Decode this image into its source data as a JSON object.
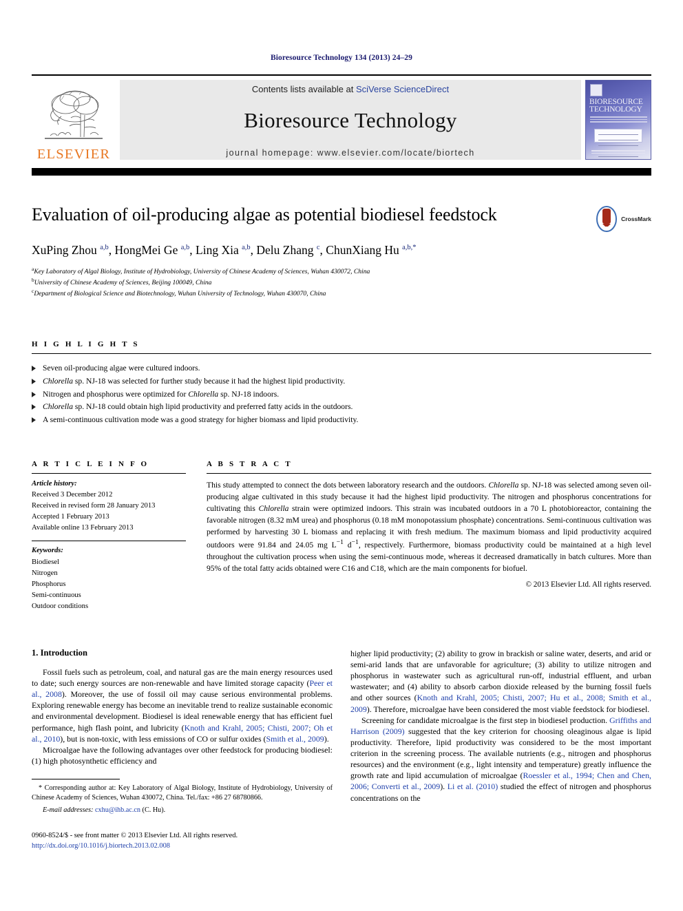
{
  "running_head": "Bioresource Technology 134 (2013) 24–29",
  "masthead": {
    "publisher_name": "ELSEVIER",
    "contents_prefix": "Contents lists available at ",
    "contents_link": "SciVerse ScienceDirect",
    "journal_name": "Bioresource Technology",
    "homepage": "journal homepage: www.elsevier.com/locate/biortech",
    "cover_title_line1": "BIORESOURCE",
    "cover_title_line2": "TECHNOLOGY"
  },
  "article": {
    "title": "Evaluation of oil-producing algae as potential biodiesel feedstock",
    "crossmark_label": "CrossMark",
    "authors_html": "XuPing Zhou <sup>a,b</sup>, HongMei Ge <sup>a,b</sup>, Ling Xia <sup>a,b</sup>, Delu Zhang <sup>c</sup>, ChunXiang Hu <sup>a,b,</sup><sup>*</sup>",
    "affiliations": [
      "Key Laboratory of Algal Biology, Institute of Hydrobiology, University of Chinese Academy of Sciences, Wuhan 430072, China",
      "University of Chinese Academy of Sciences, Beijing 100049, China",
      "Department of Biological Science and Biotechnology, Wuhan University of Technology, Wuhan 430070, China"
    ],
    "affiliation_marks": [
      "a",
      "b",
      "c"
    ]
  },
  "highlights": {
    "heading": "H I G H L I G H T S",
    "items_html": [
      "Seven oil-producing algae were cultured indoors.",
      "<i>Chlorella</i> sp. NJ-18 was selected for further study because it had the highest lipid productivity.",
      "Nitrogen and phosphorus were optimized for <i>Chlorella</i> sp. NJ-18 indoors.",
      "<i>Chlorella</i> sp. NJ-18 could obtain high lipid productivity and preferred fatty acids in the outdoors.",
      "A semi-continuous cultivation mode was a good strategy for higher biomass and lipid productivity."
    ]
  },
  "article_info": {
    "heading": "A R T I C L E    I N F O",
    "history_label": "Article history:",
    "history": [
      "Received 3 December 2012",
      "Received in revised form 28 January 2013",
      "Accepted 1 February 2013",
      "Available online 13 February 2013"
    ],
    "keywords_label": "Keywords:",
    "keywords": [
      "Biodiesel",
      "Nitrogen",
      "Phosphorus",
      "Semi-continuous",
      "Outdoor conditions"
    ]
  },
  "abstract": {
    "heading": "A B S T R A C T",
    "text_html": "This study attempted to connect the dots between laboratory research and the outdoors. <i>Chlorella</i> sp. NJ-18 was selected among seven oil-producing algae cultivated in this study because it had the highest lipid productivity. The nitrogen and phosphorus concentrations for cultivating this <i>Chlorella</i> strain were optimized indoors. This strain was incubated outdoors in a 70 L photobioreactor, containing the favorable nitrogen (8.32 mM urea) and phosphorus (0.18 mM monopotassium phosphate) concentrations. Semi-continuous cultivation was performed by harvesting 30 L biomass and replacing it with fresh medium. The maximum biomass and lipid productivity acquired outdoors were 91.84 and 24.05 mg L<sup>−1</sup> d<sup>−1</sup>, respectively. Furthermore, biomass productivity could be maintained at a high level throughout the cultivation process when using the semi-continuous mode, whereas it decreased dramatically in batch cultures. More than 95% of the total fatty acids obtained were C16 and C18, which are the main components for biofuel.",
    "copyright": "© 2013 Elsevier Ltd. All rights reserved."
  },
  "introduction": {
    "heading": "1. Introduction",
    "left_paragraphs_html": [
      "Fossil fuels such as petroleum, coal, and natural gas are the main energy resources used to date; such energy sources are non-renewable and have limited storage capacity (<span class=\"ref\">Peer et al., 2008</span>). Moreover, the use of fossil oil may cause serious environmental problems. Exploring renewable energy has become an inevitable trend to realize sustainable economic and environmental development. Biodiesel is ideal renewable energy that has efficient fuel performance, high flash point, and lubricity (<span class=\"ref\">Knoth and Krahl, 2005; Chisti, 2007; Oh et al., 2010</span>), but is non-toxic, with less emissions of CO or sulfur oxides (<span class=\"ref\">Smith et al., 2009</span>).",
      "Microalgae have the following advantages over other feedstock for producing biodiesel: (1) high photosynthetic efficiency and"
    ],
    "right_paragraphs_html": [
      "higher lipid productivity; (2) ability to grow in brackish or saline water, deserts, and arid or semi-arid lands that are unfavorable for agriculture; (3) ability to utilize nitrogen and phosphorus in wastewater such as agricultural run-off, industrial effluent, and urban wastewater; and (4) ability to absorb carbon dioxide released by the burning fossil fuels and other sources (<span class=\"ref\">Knoth and Krahl, 2005; Chisti, 2007; Hu et al., 2008; Smith et al., 2009</span>). Therefore, microalgae have been considered the most viable feedstock for biodiesel.",
      "Screening for candidate microalgae is the first step in biodiesel production. <span class=\"ref\">Griffiths and Harrison (2009)</span> suggested that the key criterion for choosing oleaginous algae is lipid productivity. Therefore, lipid productivity was considered to be the most important criterion in the screening process. The available nutrients (e.g., nitrogen and phosphorus resources) and the environment (e.g., light intensity and temperature) greatly influence the growth rate and lipid accumulation of microalgae (<span class=\"ref\">Roessler et al., 1994; Chen and Chen, 2006; Converti et al., 2009</span>). <span class=\"ref\">Li et al. (2010)</span> studied the effect of nitrogen and phosphorus concentrations on the"
    ]
  },
  "footer": {
    "corresponding_html": "* Corresponding author at: Key Laboratory of Algal Biology, Institute of Hydrobiology, University of Chinese Academy of Sciences, Wuhan 430072, China. Tel./fax: +86 27 68780866.",
    "email_label": "E-mail addresses:",
    "email_address": "cxhu@ihb.ac.cn",
    "email_suffix": "(C. Hu).",
    "issn_line": "0960-8524/$ - see front matter © 2013 Elsevier Ltd. All rights reserved.",
    "doi": "http://dx.doi.org/10.1016/j.biortech.2013.02.008"
  },
  "colors": {
    "running_head": "#1a1a6e",
    "elsevier_orange": "#E87722",
    "link_blue": "#1e3faa",
    "band_gray": "#e9e9e9"
  }
}
